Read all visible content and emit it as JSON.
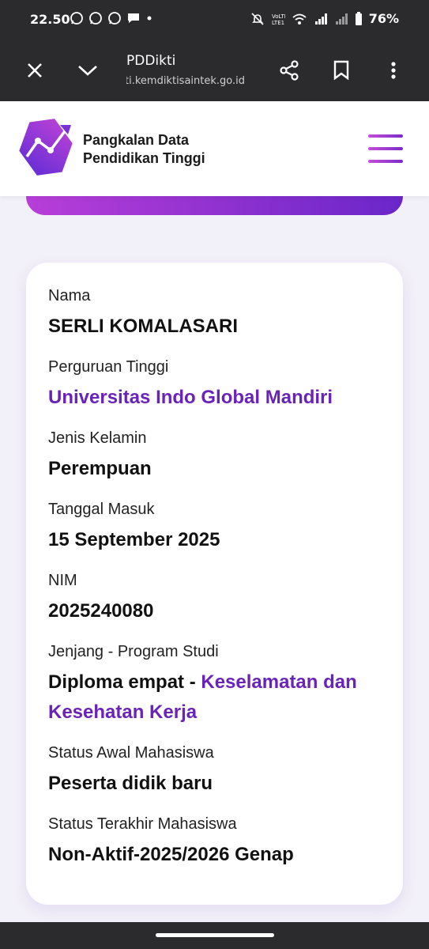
{
  "status_bar": {
    "time": "22.50",
    "battery": "76%",
    "icons": [
      "whatsapp-icon",
      "whatsapp-icon",
      "whatsapp-icon",
      "message-icon",
      "dot-icon",
      "mute-icon",
      "volte-icon",
      "wifi-icon",
      "signal-icon",
      "signal-icon",
      "battery-icon"
    ]
  },
  "browser": {
    "title": "PDDikti",
    "url": "pddikti.kemdiktisaintek.go.id",
    "icons": [
      "close-icon",
      "chevron-down-icon",
      "share-icon",
      "bookmark-icon",
      "more-icon"
    ]
  },
  "header": {
    "brand_line1": "Pangkalan Data",
    "brand_line2": "Pendidikan Tinggi",
    "menu_icon": "hamburger-icon",
    "accent_color": "#6a23b8"
  },
  "student": {
    "nama_label": "Nama",
    "nama": "SERLI KOMALASARI",
    "pt_label": "Perguruan Tinggi",
    "pt": "Universitas Indo Global Mandiri",
    "jk_label": "Jenis Kelamin",
    "jk": "Perempuan",
    "tgl_label": "Tanggal Masuk",
    "tgl": "15 September 2025",
    "nim_label": "NIM",
    "nim": "2025240080",
    "prodi_label": "Jenjang - Program Studi",
    "jenjang": "Diploma empat - ",
    "prodi": "Keselamatan dan Kesehatan Kerja",
    "status_awal_label": "Status Awal Mahasiswa",
    "status_awal": "Peserta didik baru",
    "status_akhir_label": "Status Terakhir Mahasiswa",
    "status_akhir": "Non-Aktif-2025/2026 Genap"
  }
}
